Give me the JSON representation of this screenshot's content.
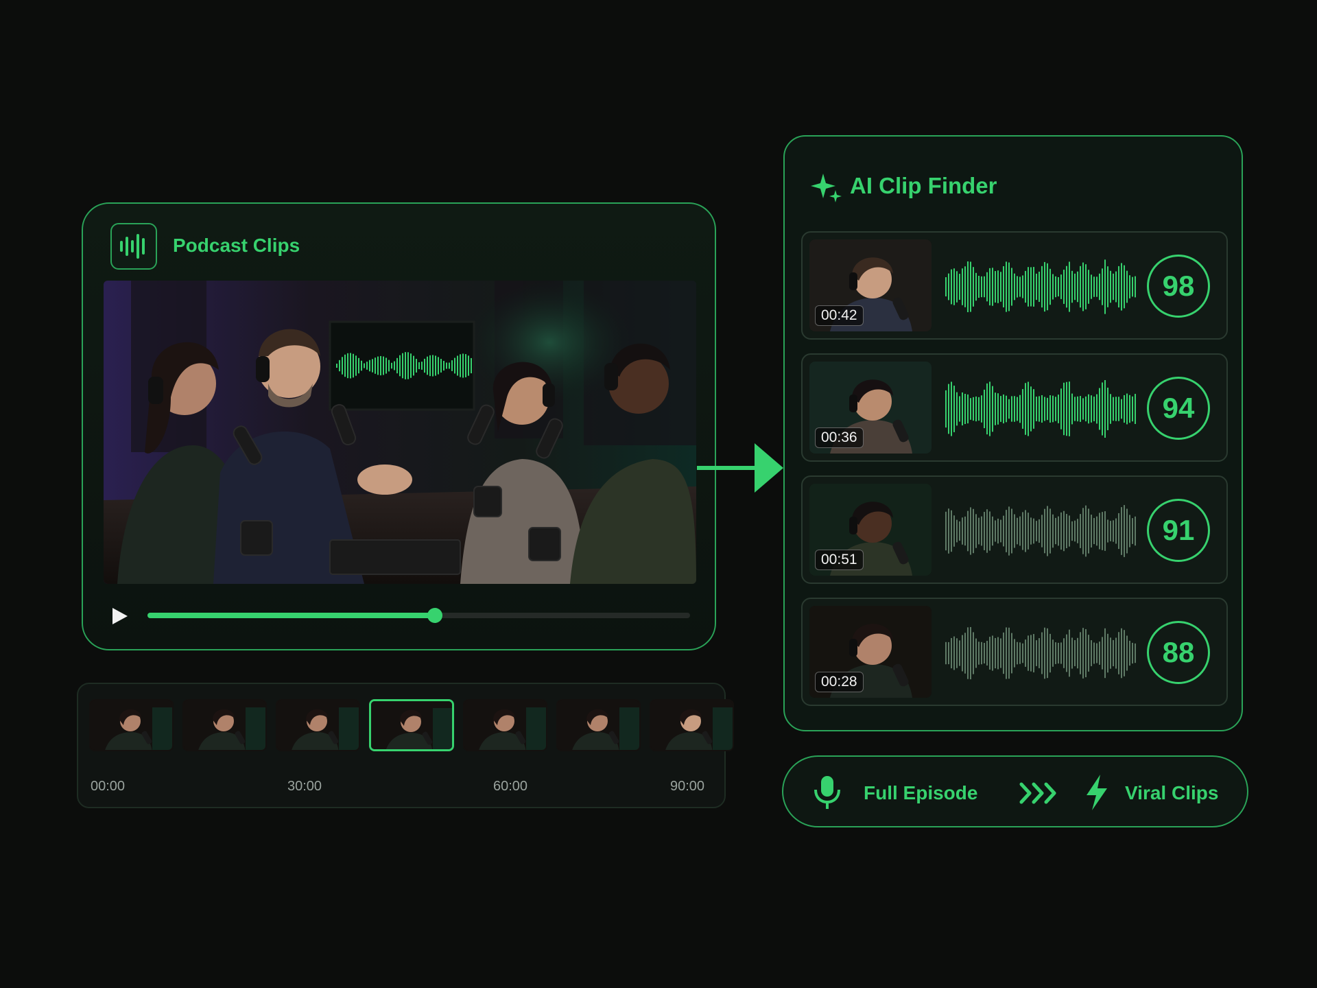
{
  "player": {
    "title": "Podcast Clips",
    "icon": "waveform-icon",
    "progress": 0.53,
    "accent": "#37d26e"
  },
  "timeline": {
    "thumbnails": 7,
    "selected_index": 3,
    "labels": [
      "00:00",
      "30:00",
      "60:00",
      "90:00"
    ]
  },
  "finder": {
    "title": "AI Clip Finder",
    "icon": "sparkle-icon",
    "clips": [
      {
        "time": "00:42",
        "score": "98",
        "active": true,
        "speaker": "man with beard"
      },
      {
        "time": "00:36",
        "score": "94",
        "active": true,
        "speaker": "woman with dark hair"
      },
      {
        "time": "00:51",
        "score": "91",
        "active": false,
        "speaker": "man in olive jacket"
      },
      {
        "time": "00:28",
        "score": "88",
        "active": false,
        "speaker": "woman with long hair"
      }
    ]
  },
  "pill": {
    "from_label": "Full Episode",
    "to_label": "Viral Clips",
    "from_icon": "microphone-icon",
    "separator_icon": "chevrons-right-icon",
    "to_icon": "lightning-icon"
  },
  "colors": {
    "background": "#0c0d0c",
    "accent": "#37d26e",
    "accent_dim": "#2aa358",
    "wave_muted": "#5f7a66"
  }
}
